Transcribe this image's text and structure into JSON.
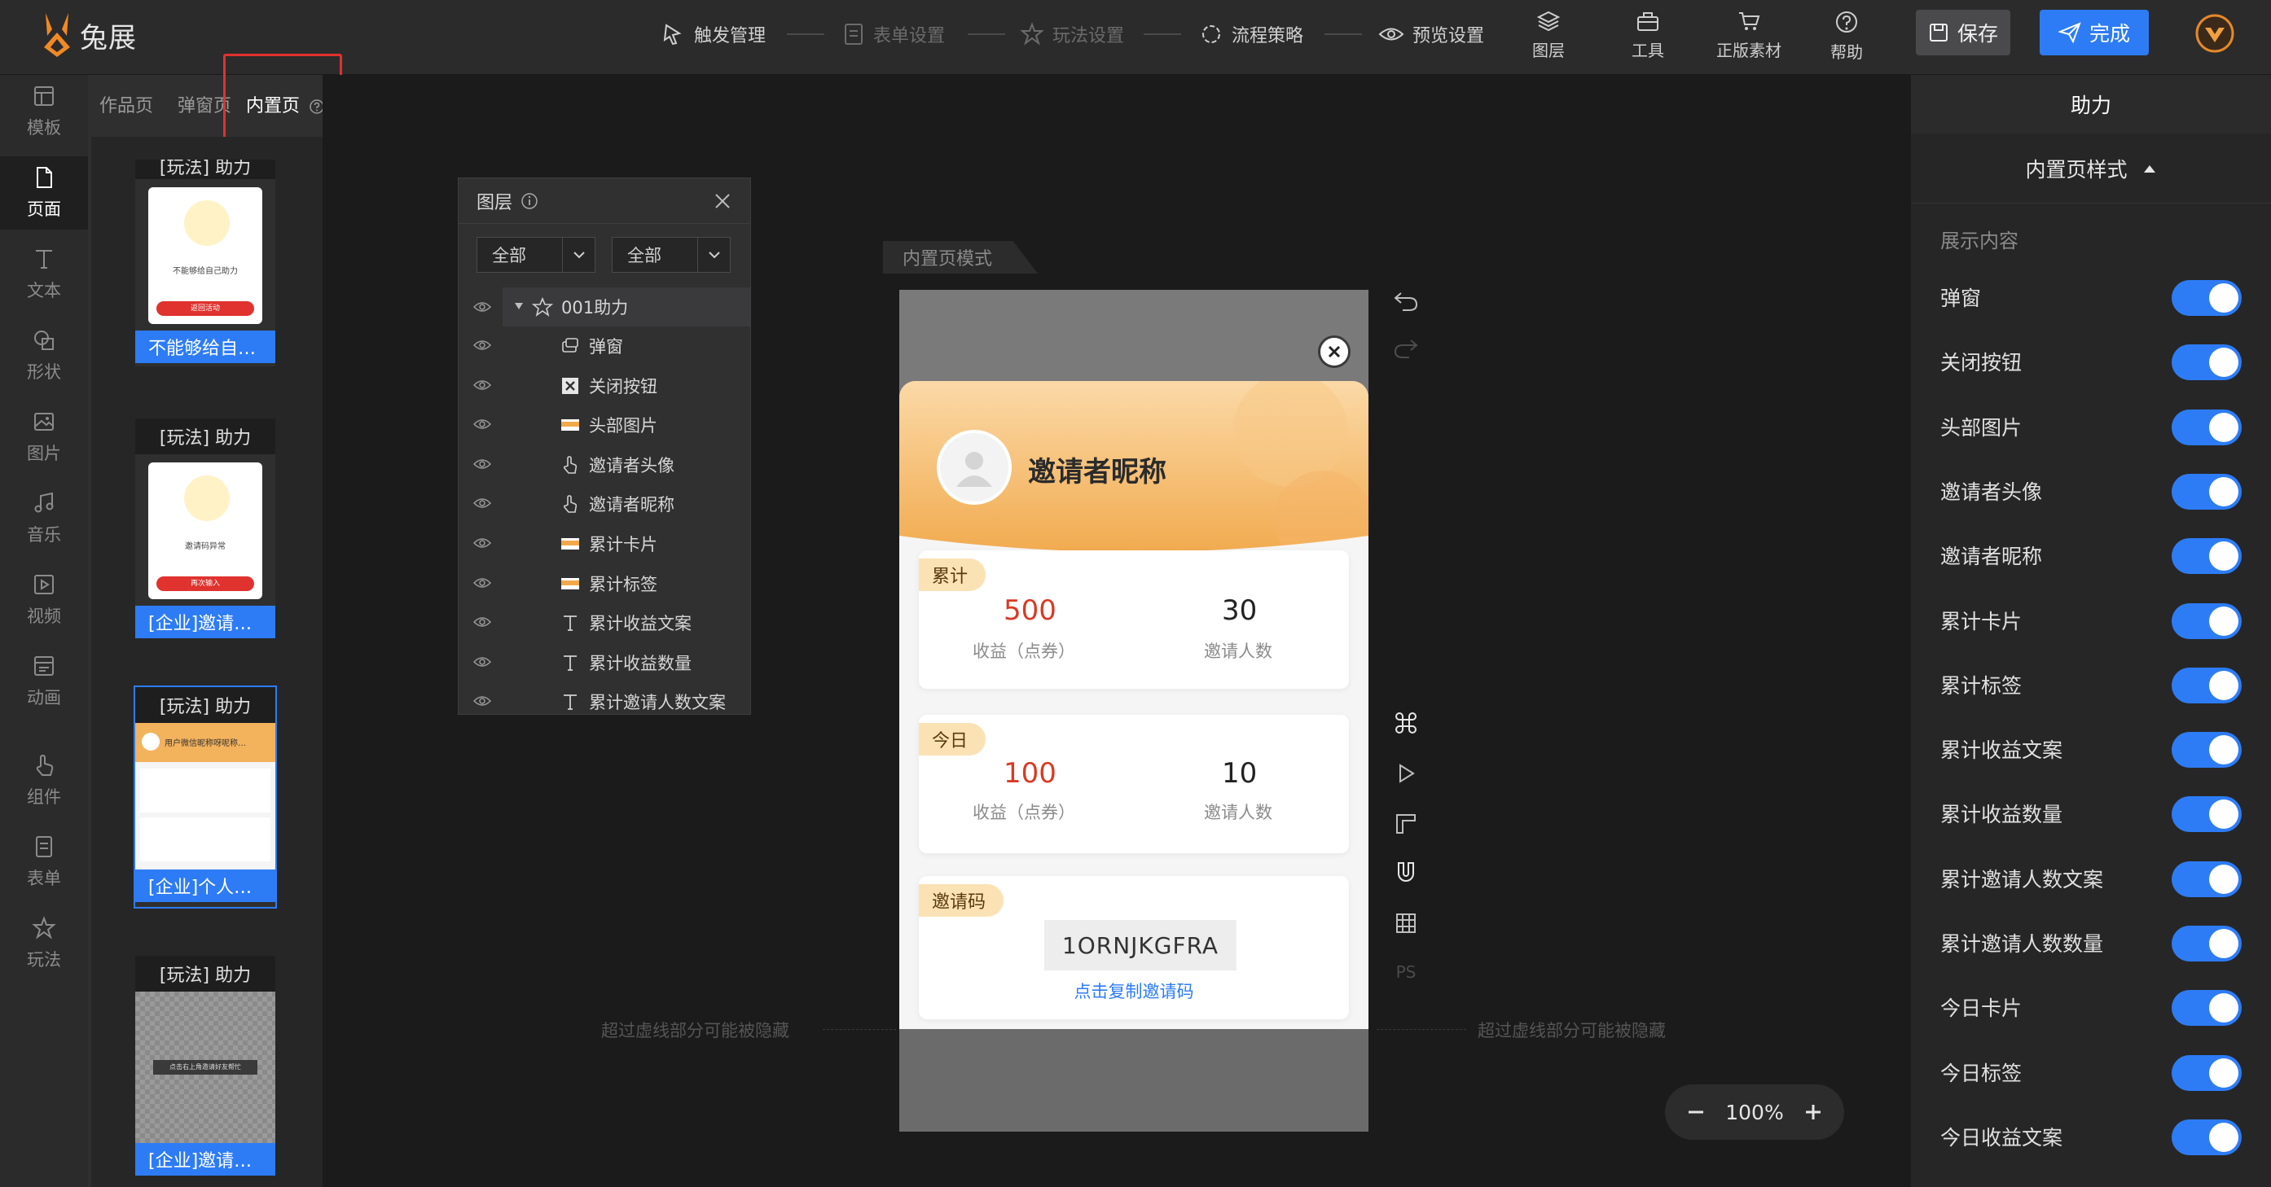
{
  "app": {
    "name": "兔展"
  },
  "steps": [
    {
      "label": "触发管理",
      "icon": "trigger-icon"
    },
    {
      "label": "表单设置",
      "icon": "form-icon"
    },
    {
      "label": "玩法设置",
      "icon": "play-icon"
    },
    {
      "label": "流程策略",
      "icon": "flow-icon"
    },
    {
      "label": "预览设置",
      "icon": "eye-icon"
    }
  ],
  "tools": [
    {
      "label": "图层",
      "icon": "layers-icon"
    },
    {
      "label": "工具",
      "icon": "toolbox-icon"
    },
    {
      "label": "正版素材",
      "icon": "cart-icon"
    },
    {
      "label": "帮助",
      "icon": "help-icon"
    }
  ],
  "actions": {
    "save": "保存",
    "done": "完成"
  },
  "rail": [
    {
      "label": "模板",
      "icon": "template-icon"
    },
    {
      "label": "页面",
      "icon": "page-icon"
    },
    {
      "label": "文本",
      "icon": "text-icon"
    },
    {
      "label": "形状",
      "icon": "shape-icon"
    },
    {
      "label": "图片",
      "icon": "image-icon"
    },
    {
      "label": "音乐",
      "icon": "music-icon"
    },
    {
      "label": "视频",
      "icon": "video-icon"
    },
    {
      "label": "动画",
      "icon": "animation-icon"
    },
    {
      "label": "组件",
      "icon": "component-icon"
    },
    {
      "label": "表单",
      "icon": "form-icon"
    },
    {
      "label": "玩法",
      "icon": "play-icon"
    }
  ],
  "page_tabs": [
    "作品页",
    "弹窗页",
    "内置页"
  ],
  "page_cards": [
    {
      "title": "[玩法] 助力",
      "name": "不能够给自…",
      "thumb_text": "不能够给自己助力",
      "thumb_btn": "返回活动"
    },
    {
      "title": "[玩法] 助力",
      "name": "[企业]邀请…",
      "thumb_text": "邀请码异常",
      "thumb_btn": "再次输入"
    },
    {
      "title": "[玩法] 助力",
      "name": "[企业]个人…",
      "thumb_text": "用户微信昵称呀呢称…"
    },
    {
      "title": "[玩法] 助力",
      "name": "[企业]邀请…",
      "thumb_text": "点击右上角邀请好友帮忙"
    }
  ],
  "layers_panel": {
    "title": "图层",
    "filter_a": "全部",
    "filter_b": "全部",
    "group": "001助力",
    "items": [
      {
        "label": "弹窗",
        "icon": "popup-icon"
      },
      {
        "label": "关闭按钮",
        "icon": "close-icon"
      },
      {
        "label": "头部图片",
        "icon": "image-icon"
      },
      {
        "label": "邀请者头像",
        "icon": "hand-icon"
      },
      {
        "label": "邀请者昵称",
        "icon": "hand-icon"
      },
      {
        "label": "累计卡片",
        "icon": "image-icon"
      },
      {
        "label": "累计标签",
        "icon": "image-icon"
      },
      {
        "label": "累计收益文案",
        "icon": "text-icon"
      },
      {
        "label": "累计收益数量",
        "icon": "text-icon"
      },
      {
        "label": "累计邀请人数文案",
        "icon": "text-icon"
      }
    ]
  },
  "canvas": {
    "mode_tag": "内置页模式",
    "hint": "超过虚线部分可能被隐藏",
    "zoom": "100%"
  },
  "preview": {
    "nickname": "邀请者昵称",
    "total": {
      "tag": "累计",
      "income": "500",
      "income_label": "收益（点券）",
      "invites": "30",
      "invites_label": "邀请人数"
    },
    "today": {
      "tag": "今日",
      "income": "100",
      "income_label": "收益（点券）",
      "invites": "10",
      "invites_label": "邀请人数"
    },
    "code": {
      "tag": "邀请码",
      "value": "1ORNJKGFRA",
      "copy": "点击复制邀请码"
    }
  },
  "right_panel": {
    "title": "助力",
    "subtitle": "内置页样式",
    "section": "展示内容",
    "toggles": [
      {
        "label": "弹窗",
        "on": true
      },
      {
        "label": "关闭按钮",
        "on": true
      },
      {
        "label": "头部图片",
        "on": true
      },
      {
        "label": "邀请者头像",
        "on": true
      },
      {
        "label": "邀请者昵称",
        "on": true
      },
      {
        "label": "累计卡片",
        "on": true
      },
      {
        "label": "累计标签",
        "on": true
      },
      {
        "label": "累计收益文案",
        "on": true
      },
      {
        "label": "累计收益数量",
        "on": true
      },
      {
        "label": "累计邀请人数文案",
        "on": true
      },
      {
        "label": "累计邀请人数数量",
        "on": true
      },
      {
        "label": "今日卡片",
        "on": true
      },
      {
        "label": "今日标签",
        "on": true
      },
      {
        "label": "今日收益文案",
        "on": true
      }
    ]
  },
  "colors": {
    "accent": "#2d7cf6",
    "highlight": "#e0322e",
    "value_red": "#d93a24",
    "header_orange": "#f3b25c"
  }
}
